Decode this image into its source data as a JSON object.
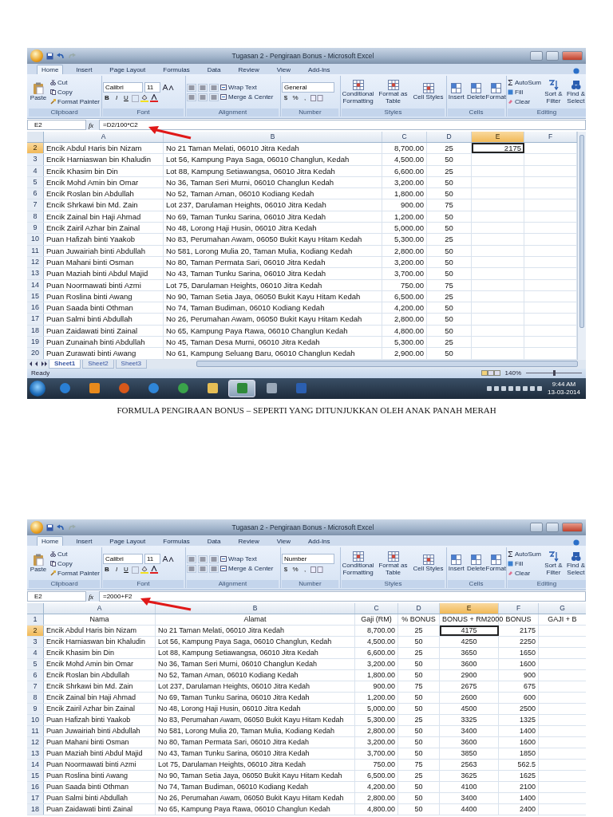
{
  "blocks": [
    {
      "kind": "screenshot",
      "title": "Tugasan 2 - Pengiraan Bonus - Microsoft Excel",
      "tabs": [
        {
          "label": "Home",
          "selected": true
        },
        {
          "label": "Insert",
          "selected": false
        },
        {
          "label": "Page Layout",
          "selected": false
        },
        {
          "label": "Formulas",
          "selected": false
        },
        {
          "label": "Data",
          "selected": false
        },
        {
          "label": "Review",
          "selected": false
        },
        {
          "label": "View",
          "selected": false
        },
        {
          "label": "Add-Ins",
          "selected": false
        }
      ],
      "ribbon": {
        "clipboard": {
          "paste": "Paste",
          "items": [
            "Cut",
            "Copy",
            "Format Painter"
          ],
          "label": "Clipboard"
        },
        "font": {
          "name": "Calibri",
          "size": "11",
          "buttons": [
            "B",
            "I",
            "U"
          ],
          "label": "Font"
        },
        "alignment": {
          "items": [
            "Wrap Text",
            "Merge & Center"
          ],
          "label": "Alignment"
        },
        "number": {
          "format": "General",
          "buttons": [
            "$",
            "%",
            ","
          ],
          "label": "Number"
        },
        "styles": {
          "items": [
            "Conditional Formatting",
            "Format as Table",
            "Cell Styles"
          ],
          "label": "Styles"
        },
        "cells": {
          "items": [
            "Insert",
            "Delete",
            "Format"
          ],
          "label": "Cells"
        },
        "editing": {
          "items": [
            "AutoSum",
            "Fill",
            "Clear"
          ],
          "big": [
            "Sort & Filter",
            "Find & Select"
          ],
          "label": "Editing"
        }
      },
      "name_box": "E2",
      "function_label": "fx",
      "formula": "=D2/100*C2",
      "columns": [
        {
          "label": "A",
          "kind": "text",
          "selected": false
        },
        {
          "label": "B",
          "kind": "text",
          "selected": false
        },
        {
          "label": "C",
          "kind": "number",
          "selected": false
        },
        {
          "label": "D",
          "kind": "center",
          "selected": false
        },
        {
          "label": "E",
          "kind": "number",
          "selected": true
        },
        {
          "label": "F",
          "kind": "number",
          "selected": false
        }
      ],
      "rows": [
        {
          "number": "2",
          "kind": "data",
          "selected": true,
          "cells": [
            "Encik Abdul Haris bin Nizam",
            "No 21 Taman Melati, 06010 Jitra Kedah",
            "8,700.00",
            "25",
            "2175"
          ]
        },
        {
          "number": "3",
          "kind": "data",
          "selected": false,
          "cells": [
            "Encik Harniaswan bin Khaludin",
            "Lot 56, Kampung Paya Saga, 06010 Changlun, Kedah",
            "4,500.00",
            "50"
          ]
        },
        {
          "number": "4",
          "kind": "data",
          "selected": false,
          "cells": [
            "Encik Khasim bin Din",
            "Lot 88, Kampung Setiawangsa, 06010 Jitra Kedah",
            "6,600.00",
            "25"
          ]
        },
        {
          "number": "5",
          "kind": "data",
          "selected": false,
          "cells": [
            "Encik Mohd Amin bin Omar",
            "No 36, Taman Seri Murni, 06010 Changlun Kedah",
            "3,200.00",
            "50"
          ]
        },
        {
          "number": "6",
          "kind": "data",
          "selected": false,
          "cells": [
            "Encik Roslan bin Abdullah",
            "No 52, Taman Aman, 06010 Kodiang Kedah",
            "1,800.00",
            "50"
          ]
        },
        {
          "number": "7",
          "kind": "data",
          "selected": false,
          "cells": [
            "Encik Shrkawi bin Md. Zain",
            "Lot 237, Darulaman Heights, 06010 Jitra Kedah",
            "900.00",
            "75"
          ]
        },
        {
          "number": "8",
          "kind": "data",
          "selected": false,
          "cells": [
            "Encik Zainal bin Haji Ahmad",
            "No 69, Taman Tunku Sarina, 06010 Jitra Kedah",
            "1,200.00",
            "50"
          ]
        },
        {
          "number": "9",
          "kind": "data",
          "selected": false,
          "cells": [
            "Encik Zairil Azhar bin Zainal",
            "No 48, Lorong Haji Husin, 06010 Jitra Kedah",
            "5,000.00",
            "50"
          ]
        },
        {
          "number": "10",
          "kind": "data",
          "selected": false,
          "cells": [
            "Puan Hafizah binti Yaakob",
            "No 83, Perumahan Awam, 06050 Bukit Kayu Hitam Kedah",
            "5,300.00",
            "25"
          ]
        },
        {
          "number": "11",
          "kind": "data",
          "selected": false,
          "cells": [
            "Puan Juwairiah binti Abdullah",
            "No 581, Lorong Mulia 20, Taman Mulia, Kodiang Kedah",
            "2,800.00",
            "50"
          ]
        },
        {
          "number": "12",
          "kind": "data",
          "selected": false,
          "cells": [
            "Puan Mahani binti Osman",
            "No 80, Taman Permata Sari, 06010 Jitra Kedah",
            "3,200.00",
            "50"
          ]
        },
        {
          "number": "13",
          "kind": "data",
          "selected": false,
          "cells": [
            "Puan Maziah binti Abdul Majid",
            "No 43, Taman Tunku Sarina, 06010 Jitra Kedah",
            "3,700.00",
            "50"
          ]
        },
        {
          "number": "14",
          "kind": "data",
          "selected": false,
          "cells": [
            "Puan Noormawati binti Azmi",
            "Lot 75, Darulaman Heights, 06010 Jitra Kedah",
            "750.00",
            "75"
          ]
        },
        {
          "number": "15",
          "kind": "data",
          "selected": false,
          "cells": [
            "Puan Roslina binti Awang",
            "No 90, Taman Setia Jaya, 06050 Bukit Kayu Hitam Kedah",
            "6,500.00",
            "25"
          ]
        },
        {
          "number": "16",
          "kind": "data",
          "selected": false,
          "cells": [
            "Puan Saada binti Othman",
            "No 74, Taman Budiman, 06010 Kodiang Kedah",
            "4,200.00",
            "50"
          ]
        },
        {
          "number": "17",
          "kind": "data",
          "selected": false,
          "cells": [
            "Puan Salmi binti Abdullah",
            "No 26, Perumahan Awam, 06050 Bukit Kayu Hitam Kedah",
            "2,800.00",
            "50"
          ]
        },
        {
          "number": "18",
          "kind": "data",
          "selected": false,
          "cells": [
            "Puan Zaidawati binti Zainal",
            "No 65, Kampung Paya Rawa, 06010 Changlun Kedah",
            "4,800.00",
            "50"
          ]
        },
        {
          "number": "19",
          "kind": "data",
          "selected": false,
          "cells": [
            "Puan Zunainah binti Abdullah",
            "No 45, Taman Desa Murni, 06010 Jitra Kedah",
            "5,300.00",
            "25"
          ]
        },
        {
          "number": "20",
          "kind": "data",
          "selected": false,
          "cells": [
            "Puan Zurawati binti Awang",
            "No 61, Kampung Seluang Baru, 06010 Changlun Kedah",
            "2,900.00",
            "50"
          ]
        }
      ],
      "sheet_tabs": [
        {
          "label": "Sheet1",
          "selected": true
        },
        {
          "label": "Sheet2",
          "selected": false
        },
        {
          "label": "Sheet3",
          "selected": false
        }
      ],
      "status": "Ready",
      "zoom": "140%",
      "zoom_slider": {
        "level": 0.5
      },
      "taskbar": {
        "apps": [
          {
            "kind": "browser",
            "selected": false
          },
          {
            "kind": "player",
            "selected": false
          },
          {
            "kind": "globe",
            "selected": false
          },
          {
            "kind": "refresh",
            "selected": false
          },
          {
            "kind": "wheel",
            "selected": false
          },
          {
            "kind": "folder",
            "selected": false
          },
          {
            "kind": "spreadsheet",
            "selected": true
          },
          {
            "kind": "viewer",
            "selected": false
          },
          {
            "kind": "document",
            "selected": false
          }
        ],
        "time": "9:44 AM",
        "date": "13-03-2014"
      }
    },
    {
      "kind": "caption",
      "text": "FORMULA PENGIRAAN BONUS – SEPERTI YANG DITUNJUKKAN OLEH ANAK PANAH MERAH"
    },
    {
      "kind": "screenshot",
      "title": "Tugasan 2 - Pengiraan Bonus - Microsoft Excel",
      "tabs": [
        {
          "label": "Home",
          "selected": true
        },
        {
          "label": "Insert",
          "selected": false
        },
        {
          "label": "Page Layout",
          "selected": false
        },
        {
          "label": "Formulas",
          "selected": false
        },
        {
          "label": "Data",
          "selected": false
        },
        {
          "label": "Review",
          "selected": false
        },
        {
          "label": "View",
          "selected": false
        },
        {
          "label": "Add-Ins",
          "selected": false
        }
      ],
      "ribbon": {
        "clipboard": {
          "paste": "Paste",
          "items": [
            "Cut",
            "Copy",
            "Format Painter"
          ],
          "label": "Clipboard"
        },
        "font": {
          "name": "Calibri",
          "size": "11",
          "buttons": [
            "B",
            "I",
            "U"
          ],
          "label": "Font"
        },
        "alignment": {
          "items": [
            "Wrap Text",
            "Merge & Center"
          ],
          "label": "Alignment"
        },
        "number": {
          "format": "Number",
          "buttons": [
            "$",
            "%",
            ","
          ],
          "label": "Number"
        },
        "styles": {
          "items": [
            "Conditional Formatting",
            "Format as Table",
            "Cell Styles"
          ],
          "label": "Styles"
        },
        "cells": {
          "items": [
            "Insert",
            "Delete",
            "Format"
          ],
          "label": "Cells"
        },
        "editing": {
          "items": [
            "AutoSum",
            "Fill",
            "Clear"
          ],
          "big": [
            "Sort & Filter",
            "Find & Select"
          ],
          "label": "Editing"
        }
      },
      "name_box": "E2",
      "function_label": "fx",
      "formula": "=2000+F2",
      "columns": [
        {
          "label": "A",
          "kind": "text",
          "selected": false
        },
        {
          "label": "B",
          "kind": "text",
          "selected": false
        },
        {
          "label": "C",
          "kind": "number",
          "selected": false
        },
        {
          "label": "D",
          "kind": "center",
          "selected": false
        },
        {
          "label": "E",
          "kind": "center",
          "selected": true
        },
        {
          "label": "F",
          "kind": "number",
          "selected": false
        },
        {
          "label": "G",
          "kind": "number",
          "selected": false
        }
      ],
      "rows": [
        {
          "number": "1",
          "kind": "header",
          "selected": false,
          "cells": [
            "Nama",
            "Alamat",
            "Gaji (RM)",
            "% BONUS",
            "BONUS + RM2000",
            "BONUS",
            "GAJI + B"
          ]
        },
        {
          "number": "2",
          "kind": "data",
          "selected": true,
          "cells": [
            "Encik Abdul Haris bin Nizam",
            "No 21 Taman Melati, 06010 Jitra Kedah",
            "8,700.00",
            "25",
            "4175",
            "2175"
          ]
        },
        {
          "number": "3",
          "kind": "data",
          "selected": false,
          "cells": [
            "Encik Harniaswan bin Khaludin",
            "Lot 56, Kampung Paya Saga, 06010 Changlun, Kedah",
            "4,500.00",
            "50",
            "4250",
            "2250"
          ]
        },
        {
          "number": "4",
          "kind": "data",
          "selected": false,
          "cells": [
            "Encik Khasim bin Din",
            "Lot 88, Kampung Setiawangsa, 06010 Jitra Kedah",
            "6,600.00",
            "25",
            "3650",
            "1650"
          ]
        },
        {
          "number": "5",
          "kind": "data",
          "selected": false,
          "cells": [
            "Encik Mohd Amin bin Omar",
            "No 36, Taman Seri Murni, 06010 Changlun Kedah",
            "3,200.00",
            "50",
            "3600",
            "1600"
          ]
        },
        {
          "number": "6",
          "kind": "data",
          "selected": false,
          "cells": [
            "Encik Roslan bin Abdullah",
            "No 52, Taman Aman, 06010 Kodiang Kedah",
            "1,800.00",
            "50",
            "2900",
            "900"
          ]
        },
        {
          "number": "7",
          "kind": "data",
          "selected": false,
          "cells": [
            "Encik Shrkawi bin Md. Zain",
            "Lot 237, Darulaman Heights, 06010 Jitra Kedah",
            "900.00",
            "75",
            "2675",
            "675"
          ]
        },
        {
          "number": "8",
          "kind": "data",
          "selected": false,
          "cells": [
            "Encik Zainal bin Haji Ahmad",
            "No 69, Taman Tunku Sarina, 06010 Jitra Kedah",
            "1,200.00",
            "50",
            "2600",
            "600"
          ]
        },
        {
          "number": "9",
          "kind": "data",
          "selected": false,
          "cells": [
            "Encik Zairil Azhar bin Zainal",
            "No 48, Lorong Haji Husin, 06010 Jitra Kedah",
            "5,000.00",
            "50",
            "4500",
            "2500"
          ]
        },
        {
          "number": "10",
          "kind": "data",
          "selected": false,
          "cells": [
            "Puan Hafizah binti Yaakob",
            "No 83, Perumahan Awam, 06050 Bukit Kayu Hitam Kedah",
            "5,300.00",
            "25",
            "3325",
            "1325"
          ]
        },
        {
          "number": "11",
          "kind": "data",
          "selected": false,
          "cells": [
            "Puan Juwairiah binti Abdullah",
            "No 581, Lorong Mulia 20, Taman Mulia, Kodiang Kedah",
            "2,800.00",
            "50",
            "3400",
            "1400"
          ]
        },
        {
          "number": "12",
          "kind": "data",
          "selected": false,
          "cells": [
            "Puan Mahani binti Osman",
            "No 80, Taman Permata Sari, 06010 Jitra Kedah",
            "3,200.00",
            "50",
            "3600",
            "1600"
          ]
        },
        {
          "number": "13",
          "kind": "data",
          "selected": false,
          "cells": [
            "Puan Maziah binti Abdul Majid",
            "No 43, Taman Tunku Sarina, 06010 Jitra Kedah",
            "3,700.00",
            "50",
            "3850",
            "1850"
          ]
        },
        {
          "number": "14",
          "kind": "data",
          "selected": false,
          "cells": [
            "Puan Noormawati binti Azmi",
            "Lot 75, Darulaman Heights, 06010 Jitra Kedah",
            "750.00",
            "75",
            "2563",
            "562.5"
          ]
        },
        {
          "number": "15",
          "kind": "data",
          "selected": false,
          "cells": [
            "Puan Roslina binti Awang",
            "No 90, Taman Setia Jaya, 06050 Bukit Kayu Hitam Kedah",
            "6,500.00",
            "25",
            "3625",
            "1625"
          ]
        },
        {
          "number": "16",
          "kind": "data",
          "selected": false,
          "cells": [
            "Puan Saada binti Othman",
            "No 74, Taman Budiman, 06010 Kodiang Kedah",
            "4,200.00",
            "50",
            "4100",
            "2100"
          ]
        },
        {
          "number": "17",
          "kind": "data",
          "selected": false,
          "cells": [
            "Puan Salmi binti Abdullah",
            "No 26, Perumahan Awam, 06050 Bukit Kayu Hitam Kedah",
            "2,800.00",
            "50",
            "3400",
            "1400"
          ]
        },
        {
          "number": "18",
          "kind": "data",
          "selected": false,
          "cells": [
            "Puan Zaidawati binti Zainal",
            "No 65, Kampung Paya Rawa, 06010 Changlun Kedah",
            "4,800.00",
            "50",
            "4400",
            "2400"
          ]
        }
      ]
    }
  ]
}
